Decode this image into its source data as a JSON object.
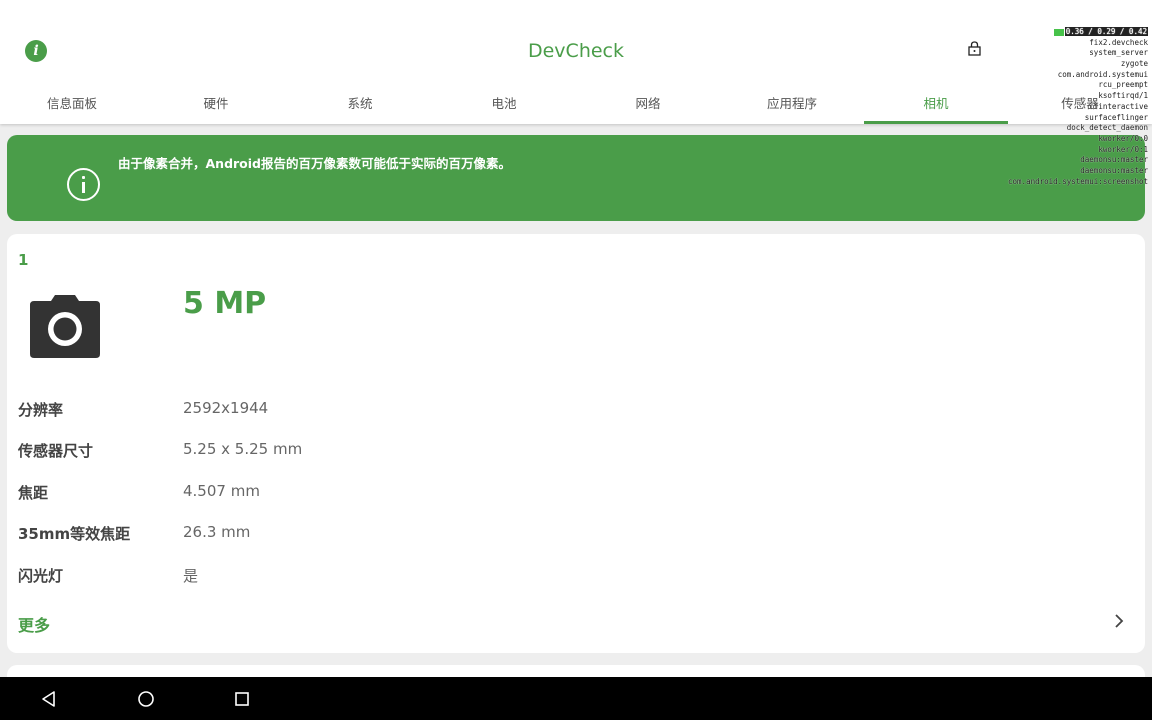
{
  "app": {
    "title": "DevCheck",
    "info_icon": "info-icon"
  },
  "tabs": [
    {
      "label": "信息面板"
    },
    {
      "label": "硬件"
    },
    {
      "label": "系统"
    },
    {
      "label": "电池"
    },
    {
      "label": "网络"
    },
    {
      "label": "应用程序"
    },
    {
      "label": "相机",
      "active": true
    },
    {
      "label": "传感器"
    }
  ],
  "banner": {
    "text": "由于像素合并，Android报告的百万像素数可能低于实际的百万像素。",
    "icon": "info-circle-icon"
  },
  "camera": {
    "index": "1",
    "icon": "camera-icon",
    "megapixels": "5 MP",
    "specs": [
      {
        "label": "分辨率",
        "value": "2592x1944"
      },
      {
        "label": "传感器尺寸",
        "value": "5.25 x 5.25 mm"
      },
      {
        "label": "焦距",
        "value": "4.507 mm"
      },
      {
        "label": "35mm等效焦距",
        "value": "26.3 mm"
      },
      {
        "label": "闪光灯",
        "value": "是"
      }
    ],
    "more_label": "更多",
    "more_icon": "chevron-right-icon"
  },
  "overlay": {
    "lines": [
      "0.36 / 0.29 / 0.42",
      "fix2.devcheck",
      "system_server",
      "zygote",
      "com.android.systemui",
      "rcu_preempt",
      "ksoftirqd/1",
      "cfinteractive",
      "surfaceflinger",
      "dock_detect_daemon",
      "kworker/0:0",
      "kworker/0:1",
      "daemonsu:master",
      "daemonsu:master",
      "com.android.systemui:screenshot"
    ]
  },
  "navbar": {
    "back_icon": "back-triangle-icon",
    "home_icon": "home-circle-icon",
    "recents_icon": "recents-square-icon"
  },
  "colors": {
    "accent": "#4a9d49",
    "background": "#eeeeee",
    "card": "#ffffff",
    "navbar": "#000000"
  }
}
